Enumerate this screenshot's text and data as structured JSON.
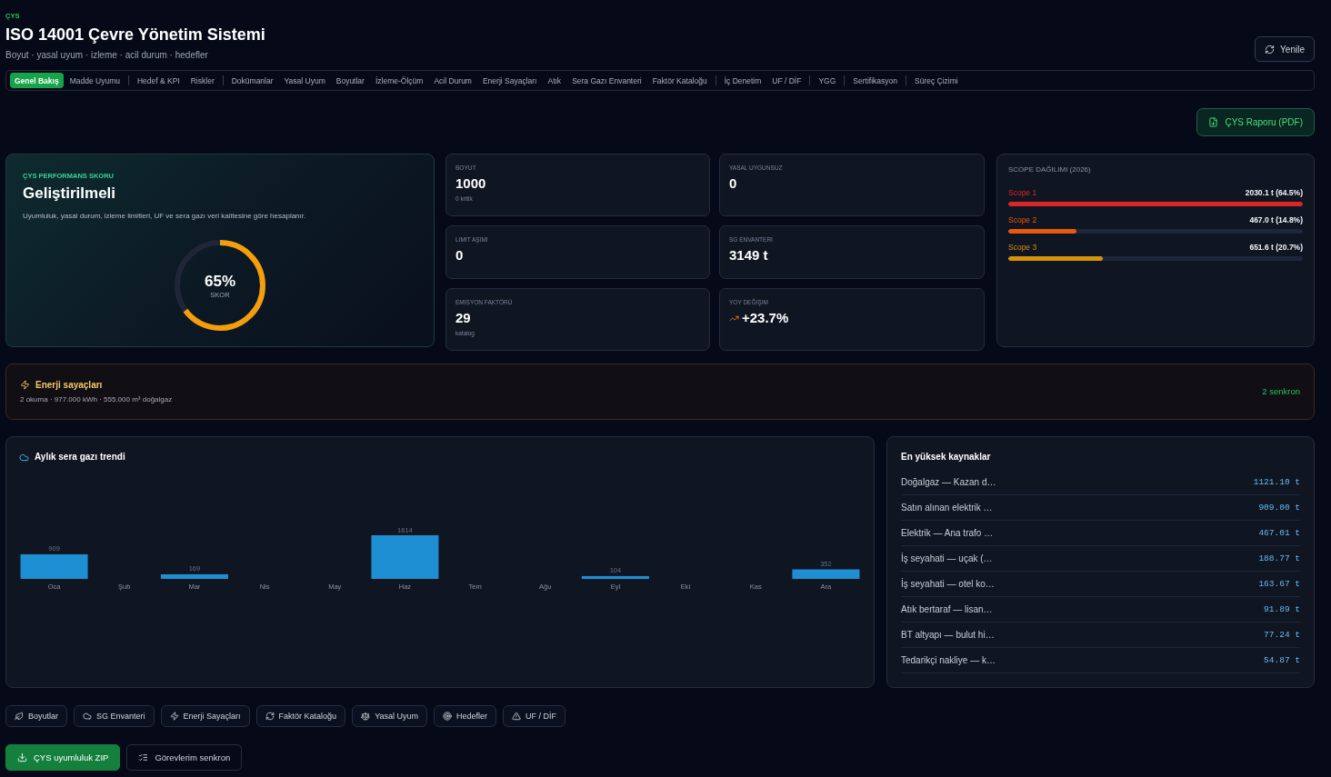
{
  "header": {
    "eyebrow": "ÇYS",
    "title": "ISO 14001 Çevre Yönetim Sistemi",
    "subtitle": "Boyut · yasal uyum · izleme · acil durum · hedefler",
    "refresh_button": "Yenile"
  },
  "tab_groups": [
    [
      {
        "label": "Genel Bakış",
        "selected": true
      },
      {
        "label": "Madde Uyumu",
        "selected": false
      }
    ],
    [
      {
        "label": "Hedef & KPI",
        "selected": false
      },
      {
        "label": "Riskler",
        "selected": false
      }
    ],
    [
      {
        "label": "Dokümanlar",
        "selected": false
      },
      {
        "label": "Yasal Uyum",
        "selected": false
      },
      {
        "label": "Boyutlar",
        "selected": false
      },
      {
        "label": "İzleme-Ölçüm",
        "selected": false
      },
      {
        "label": "Acil Durum",
        "selected": false
      },
      {
        "label": "Enerji Sayaçları",
        "selected": false
      },
      {
        "label": "Atık",
        "selected": false
      },
      {
        "label": "Sera Gazı Envanteri",
        "selected": false
      },
      {
        "label": "Faktör Kataloğu",
        "selected": false
      }
    ],
    [
      {
        "label": "İç Denetim",
        "selected": false
      },
      {
        "label": "UF / DİF",
        "selected": false
      }
    ],
    [
      {
        "label": "YGG",
        "selected": false
      }
    ],
    [
      {
        "label": "Sertifikasyon",
        "selected": false
      }
    ],
    [
      {
        "label": "Süreç Çizimi",
        "selected": false
      }
    ]
  ],
  "report_button": "ÇYS Raporu (PDF)",
  "score_card": {
    "label": "ÇYS PERFORMANS SKORU",
    "rating": "Geliştirilmeli",
    "description": "Uyumluluk, yasal durum, izleme limitleri, UF ve sera gazı veri kalitesine göre hesaplanır.",
    "level": 0.65,
    "score": "65%",
    "score_caption": "SKOR"
  },
  "stats": [
    {
      "kind": "plain",
      "label": "BOYUT",
      "value": "1000",
      "note": "0 kritik"
    },
    {
      "kind": "plain",
      "label": "YASAL UYGUNSUZ",
      "value": "0"
    },
    {
      "kind": "plain",
      "label": "LIMIT AŞIMI",
      "value": "0"
    },
    {
      "kind": "plain",
      "label": "SG ENVANTERI",
      "value": "3149 t"
    },
    {
      "kind": "plain",
      "label": "EMISYON FAKTÖRÜ",
      "value": "29",
      "note": "katalog"
    },
    {
      "kind": "rising",
      "label": "YOY DEĞIŞIM",
      "value": "+23.7%"
    }
  ],
  "scope_card": {
    "title": "SCOPE DAĞILIMI (2026)",
    "scopes": [
      {
        "name": "Scope 1",
        "reading": "2030.1 t (64.5%)",
        "level": 1.0,
        "color": "#dc2626"
      },
      {
        "name": "Scope 2",
        "reading": "467.0 t (14.8%)",
        "level": 0.23,
        "color": "#ea580c"
      },
      {
        "name": "Scope 3",
        "reading": "651.6 t (20.7%)",
        "level": 0.32,
        "color": "#d4930a"
      }
    ]
  },
  "energy_banner": {
    "title": "Enerji sayaçları",
    "summary": "2 okuma · 977.000 kWh · 555.000 m³ doğalgaz",
    "status": "2 senkron"
  },
  "trend_chart": {
    "title": "Aylık sera gazı trendi",
    "chart_data": {
      "type": "bar",
      "categories": [
        "Oca",
        "Şub",
        "Mar",
        "Nis",
        "May",
        "Haz",
        "Tem",
        "Ağu",
        "Eyl",
        "Eki",
        "Kas",
        "Ara"
      ],
      "values": [
        909,
        null,
        169,
        null,
        null,
        1614,
        null,
        null,
        104,
        null,
        null,
        352
      ],
      "data_labels": true
    }
  },
  "top_sources": {
    "title": "En yüksek kaynaklar",
    "rows": [
      {
        "name": "Doğalgaz — Kazan d…",
        "amount": "1121.10 t"
      },
      {
        "name": "Satın alınan elektrik …",
        "amount": "909.00 t"
      },
      {
        "name": "Elektrik — Ana trafo …",
        "amount": "467.01 t"
      },
      {
        "name": "İş seyahati — uçak (…",
        "amount": "188.77 t"
      },
      {
        "name": "İş seyahati — otel ko…",
        "amount": "163.67 t"
      },
      {
        "name": "Atık bertaraf — lisan…",
        "amount": "91.89 t"
      },
      {
        "name": "BT altyapı — bulut hi…",
        "amount": "77.24 t"
      },
      {
        "name": "Tedarikçi nakliye — k…",
        "amount": "54.87 t"
      }
    ]
  },
  "shortcut_buttons": [
    "Boyutlar",
    "SG Envanteri",
    "Enerji Sayaçları",
    "Faktör Kataloğu",
    "Yasal Uyum",
    "Hedefler",
    "UF / DİF"
  ],
  "action_buttons": [
    {
      "label": "ÇYS uyumluluk ZIP",
      "kind": "primary"
    },
    {
      "label": "Görevlerim senkron",
      "kind": "secondary"
    }
  ]
}
